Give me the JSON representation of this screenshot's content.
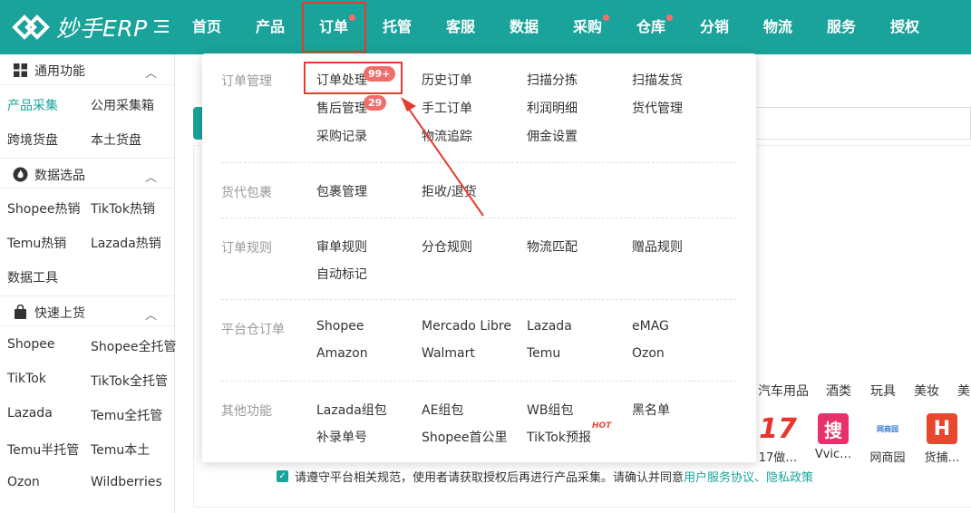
{
  "app": {
    "name": "妙手ERP"
  },
  "nav": {
    "items": [
      {
        "label": "首页",
        "dot": false
      },
      {
        "label": "产品",
        "dot": false
      },
      {
        "label": "订单",
        "dot": true
      },
      {
        "label": "托管",
        "dot": false
      },
      {
        "label": "客服",
        "dot": false
      },
      {
        "label": "数据",
        "dot": false
      },
      {
        "label": "采购",
        "dot": true
      },
      {
        "label": "仓库",
        "dot": true
      },
      {
        "label": "分销",
        "dot": false
      },
      {
        "label": "物流",
        "dot": false
      },
      {
        "label": "服务",
        "dot": false
      },
      {
        "label": "授权",
        "dot": false
      }
    ],
    "active": "订单"
  },
  "sidebar": {
    "sections": [
      {
        "title": "通用功能",
        "icon": "grid-icon",
        "items": [
          "产品采集",
          "公用采集箱",
          "跨境货盘",
          "本土货盘"
        ]
      },
      {
        "title": "数据选品",
        "icon": "flame-icon",
        "items": [
          "Shopee热销",
          "TikTok热销",
          "Temu热销",
          "Lazada热销",
          "数据工具"
        ]
      },
      {
        "title": "快速上货",
        "icon": "bag-icon",
        "items": [
          "Shopee",
          "Shopee全托管",
          "TikTok",
          "TikTok全托管",
          "Lazada",
          "Temu全托管",
          "Temu半托管",
          "Temu本土",
          "Ozon",
          "Wildberries"
        ]
      }
    ],
    "active_item": "产品采集"
  },
  "dropdown": {
    "sections": [
      {
        "label": "订单管理",
        "items": [
          "订单处理",
          "历史订单",
          "扫描分拣",
          "扫描发货",
          "售后管理",
          "手工订单",
          "利润明细",
          "货代管理",
          "采购记录",
          "物流追踪",
          "佣金设置"
        ]
      },
      {
        "label": "货代包裹",
        "items": [
          "包裹管理",
          "拒收/退货"
        ]
      },
      {
        "label": "订单规则",
        "items": [
          "审单规则",
          "分仓规则",
          "物流匹配",
          "赠品规则",
          "自动标记"
        ]
      },
      {
        "label": "平台仓订单",
        "items": [
          "Shopee",
          "Mercado Libre",
          "Lazada",
          "eMAG",
          "Amazon",
          "Walmart",
          "Temu",
          "Ozon"
        ]
      },
      {
        "label": "其他功能",
        "items": [
          "Lazada组包",
          "AE组包",
          "WB组包",
          "黑名单",
          "补录单号",
          "Shopee首公里",
          "TikTok预报"
        ]
      }
    ],
    "badges": {
      "order_processing": "99+",
      "after_sales": "29"
    },
    "hot_label": "HOT"
  },
  "background": {
    "categories": [
      "汽车用品",
      "酒类",
      "玩具",
      "美妆",
      "美"
    ],
    "apps": [
      {
        "label": "17做…",
        "icon": "17",
        "color": "#e8362e"
      },
      {
        "label": "Vvic…",
        "icon": "搜",
        "color": "#e8306a"
      },
      {
        "label": "网商园",
        "icon": "网商园",
        "color": "#3a7bd5"
      },
      {
        "label": "货捕…",
        "icon": "H",
        "color": "#e8472e"
      }
    ],
    "agreement": {
      "text": "请遵守平台相关规范，使用者请获取授权后再进行产品采集。请确认并同意",
      "links": "用户服务协议、隐私政策"
    }
  }
}
